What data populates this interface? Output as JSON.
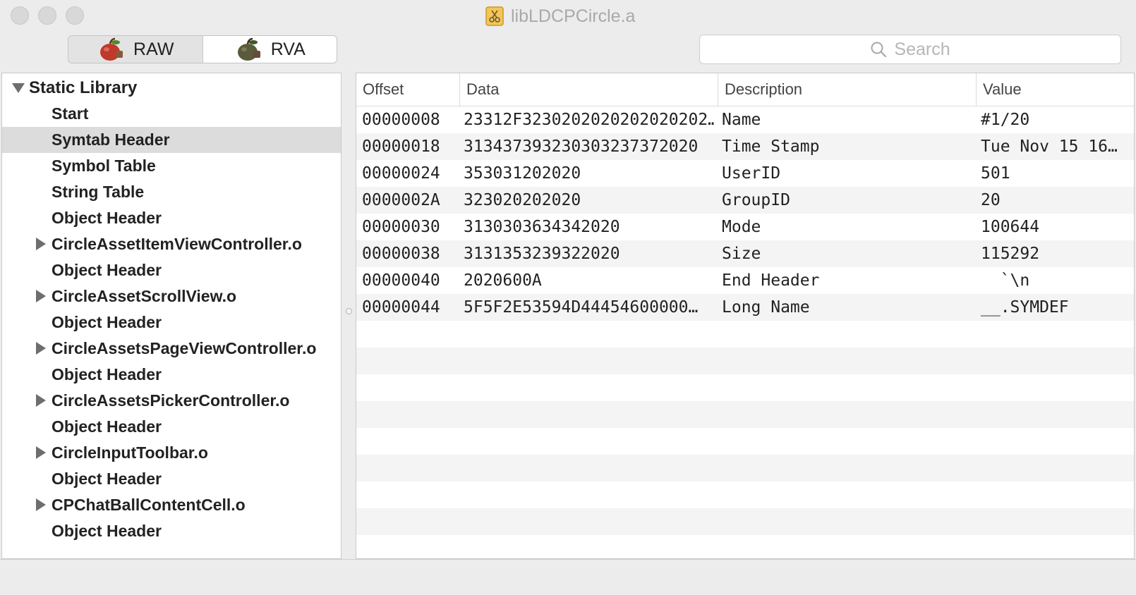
{
  "window": {
    "title": "libLDCPCircle.a"
  },
  "mode_switch": {
    "raw_label": "RAW",
    "rva_label": "RVA",
    "selected": "RAW"
  },
  "search": {
    "placeholder": "Search"
  },
  "outline": {
    "root": "Static Library",
    "items": [
      {
        "label": "Start",
        "expandable": false
      },
      {
        "label": "Symtab Header",
        "expandable": false,
        "selected": true
      },
      {
        "label": "Symbol Table",
        "expandable": false
      },
      {
        "label": "String Table",
        "expandable": false
      },
      {
        "label": "Object Header",
        "expandable": false
      },
      {
        "label": "CircleAssetItemViewController.o",
        "expandable": true
      },
      {
        "label": "Object Header",
        "expandable": false
      },
      {
        "label": "CircleAssetScrollView.o",
        "expandable": true
      },
      {
        "label": "Object Header",
        "expandable": false
      },
      {
        "label": "CircleAssetsPageViewController.o",
        "expandable": true
      },
      {
        "label": "Object Header",
        "expandable": false
      },
      {
        "label": "CircleAssetsPickerController.o",
        "expandable": true
      },
      {
        "label": "Object Header",
        "expandable": false
      },
      {
        "label": "CircleInputToolbar.o",
        "expandable": true
      },
      {
        "label": "Object Header",
        "expandable": false
      },
      {
        "label": "CPChatBallContentCell.o",
        "expandable": true
      },
      {
        "label": "Object Header",
        "expandable": false
      }
    ]
  },
  "table": {
    "columns": [
      "Offset",
      "Data",
      "Description",
      "Value"
    ],
    "rows": [
      {
        "offset": "00000008",
        "data": "23312F3230202020202020202…",
        "description": "Name",
        "value": "#1/20"
      },
      {
        "offset": "00000018",
        "data": "313437393230303237372020",
        "description": "Time Stamp",
        "value": "Tue Nov 15 16…"
      },
      {
        "offset": "00000024",
        "data": "353031202020",
        "description": "UserID",
        "value": "501"
      },
      {
        "offset": "0000002A",
        "data": "323020202020",
        "description": "GroupID",
        "value": "20"
      },
      {
        "offset": "00000030",
        "data": "3130303634342020",
        "description": "Mode",
        "value": "100644"
      },
      {
        "offset": "00000038",
        "data": "3131353239322020",
        "description": "Size",
        "value": "115292"
      },
      {
        "offset": "00000040",
        "data": "2020600A",
        "description": "End Header",
        "value": "  `\\n"
      },
      {
        "offset": "00000044",
        "data": "5F5F2E53594D44454600000…",
        "description": "Long Name",
        "value": "__.SYMDEF"
      }
    ]
  },
  "colors": {
    "window_bg": "#ececec",
    "selection": "#dcdcdc",
    "row_alt": "#f4f4f4"
  }
}
